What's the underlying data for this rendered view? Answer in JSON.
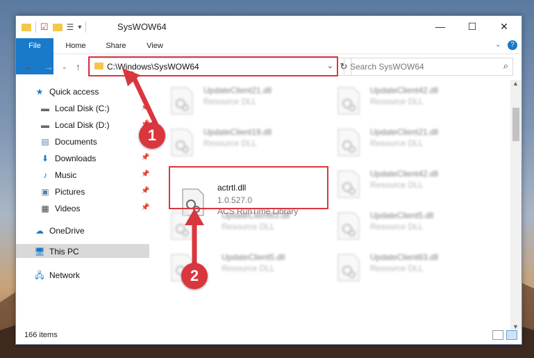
{
  "window": {
    "title": "SysWOW64"
  },
  "ribbon": {
    "tabs": [
      "File",
      "Home",
      "Share",
      "View"
    ]
  },
  "address": {
    "path": "C:\\Windows\\SysWOW64"
  },
  "search": {
    "placeholder": "Search SysWOW64"
  },
  "nav": {
    "items": [
      {
        "label": "Quick access",
        "icon": "star-icon",
        "pinned": false
      },
      {
        "label": "Local Disk (C:)",
        "icon": "drive-icon",
        "pinned": true
      },
      {
        "label": "Local Disk (D:)",
        "icon": "drive-icon",
        "pinned": true
      },
      {
        "label": "Documents",
        "icon": "document-icon",
        "pinned": true
      },
      {
        "label": "Downloads",
        "icon": "download-icon",
        "pinned": true
      },
      {
        "label": "Music",
        "icon": "music-icon",
        "pinned": true
      },
      {
        "label": "Pictures",
        "icon": "picture-icon",
        "pinned": true
      },
      {
        "label": "Videos",
        "icon": "video-icon",
        "pinned": true
      },
      {
        "label": "OneDrive",
        "icon": "cloud-icon",
        "pinned": false
      },
      {
        "label": "This PC",
        "icon": "computer-icon",
        "pinned": false
      },
      {
        "label": "Network",
        "icon": "network-icon",
        "pinned": false
      }
    ]
  },
  "files": [
    {
      "name": "UpdateClient21.dll",
      "type": "Resource DLL"
    },
    {
      "name": "UpdateClient42.dll",
      "type": "Resource DLL"
    },
    {
      "name": "UpdateClient19.dll",
      "type": "Resource DLL"
    },
    {
      "name": "UpdateClient21.dll",
      "type": "Resource DLL"
    },
    {
      "name": "actrtl.dll",
      "version": "1.0.527.0",
      "type": "ACS RunTime Library"
    },
    {
      "name": "UpdateClient42.dll",
      "type": "Resource DLL"
    },
    {
      "name": "UpdateClient63.dll",
      "type": "Resource DLL"
    },
    {
      "name": "UpdateClient5.dll",
      "type": "Resource DLL"
    },
    {
      "name": "UpdateClient5.dll",
      "type": "Resource DLL"
    },
    {
      "name": "UpdateClient63.dll",
      "type": "Resource DLL"
    }
  ],
  "status": {
    "count": "166 items"
  },
  "annotations": {
    "step1": "1",
    "step2": "2"
  },
  "colors": {
    "accent": "#1979ca",
    "highlight": "#d9363e"
  }
}
